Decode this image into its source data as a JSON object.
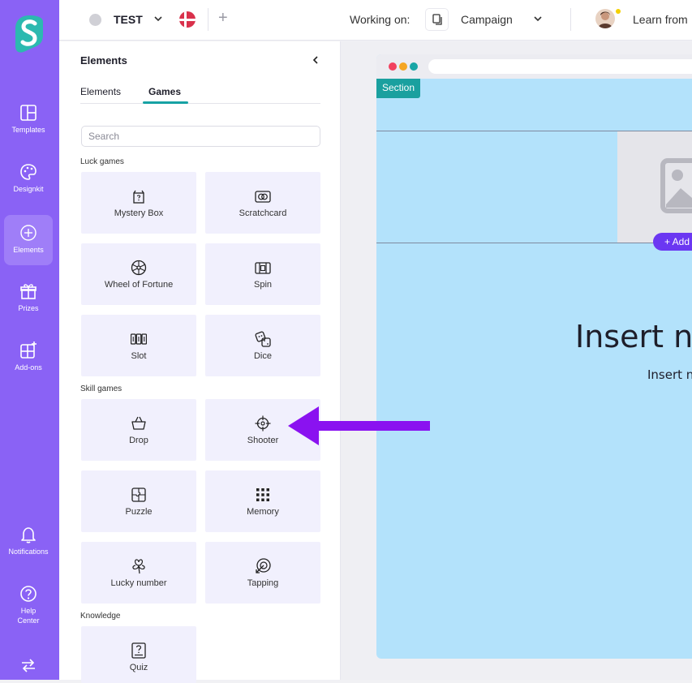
{
  "app": {
    "project_name": "TEST",
    "working_on_label": "Working on:",
    "campaign_label": "Campaign",
    "learn_label": "Learn from",
    "accent_color": "#8a62f5",
    "teal_color": "#17a2a4"
  },
  "sidebar": {
    "items": [
      {
        "label": "Templates",
        "icon": "templates-icon"
      },
      {
        "label": "Designkit",
        "icon": "palette-icon"
      },
      {
        "label": "Elements",
        "icon": "plus-circle-icon",
        "active": true
      },
      {
        "label": "Prizes",
        "icon": "gift-icon"
      },
      {
        "label": "Add-ons",
        "icon": "add-ons-icon"
      },
      {
        "label": "Notifications",
        "icon": "bell-icon"
      },
      {
        "label": "Help Center",
        "icon": "help-icon"
      }
    ]
  },
  "panel": {
    "title": "Elements",
    "tabs": [
      {
        "label": "Elements",
        "active": false
      },
      {
        "label": "Games",
        "active": true
      }
    ],
    "search_placeholder": "Search",
    "groups": [
      {
        "label": "Luck games",
        "items": [
          {
            "label": "Mystery Box",
            "icon": "mystery-box-icon"
          },
          {
            "label": "Scratchcard",
            "icon": "scratchcard-icon"
          },
          {
            "label": "Wheel of Fortune",
            "icon": "wheel-icon"
          },
          {
            "label": "Spin",
            "icon": "spin-icon"
          },
          {
            "label": "Slot",
            "icon": "slot-icon"
          },
          {
            "label": "Dice",
            "icon": "dice-icon"
          }
        ]
      },
      {
        "label": "Skill games",
        "items": [
          {
            "label": "Drop",
            "icon": "basket-icon"
          },
          {
            "label": "Shooter",
            "icon": "crosshair-icon"
          },
          {
            "label": "Puzzle",
            "icon": "puzzle-icon"
          },
          {
            "label": "Memory",
            "icon": "grid-dots-icon"
          },
          {
            "label": "Lucky number",
            "icon": "clover-icon"
          },
          {
            "label": "Tapping",
            "icon": "target-tap-icon"
          }
        ]
      },
      {
        "label": "Knowledge",
        "items": [
          {
            "label": "Quiz",
            "icon": "quiz-icon"
          }
        ]
      }
    ]
  },
  "canvas": {
    "section_label": "Section",
    "add_button_label": "+ Add",
    "headline": "Insert n",
    "subline": "Insert n"
  }
}
